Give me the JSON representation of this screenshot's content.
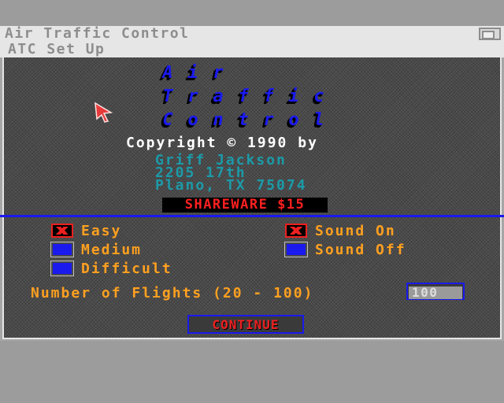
{
  "window": {
    "title": "Air Traffic Control",
    "menu": "ATC Set Up"
  },
  "logo": {
    "row1": [
      "A",
      "i",
      "r"
    ],
    "row2": [
      "T",
      "r",
      "a",
      "f",
      "f",
      "i",
      "c"
    ],
    "row3": [
      "C",
      "o",
      "n",
      "t",
      "r",
      "o",
      "l"
    ]
  },
  "info": {
    "copyright": "Copyright © 1990 by",
    "author": "Griff Jackson",
    "street": "2205 17th",
    "city": "Plano, TX 75074",
    "shareware": "SHAREWARE $15"
  },
  "difficulty": {
    "options": [
      {
        "label": "Easy",
        "checked": true
      },
      {
        "label": "Medium",
        "checked": false
      },
      {
        "label": "Difficult",
        "checked": false
      }
    ]
  },
  "sound": {
    "options": [
      {
        "label": "Sound On",
        "checked": true
      },
      {
        "label": "Sound Off",
        "checked": false
      }
    ]
  },
  "flights": {
    "label": "Number of Flights (20 - 100)",
    "value": "100"
  },
  "continue_label": "CONTINUE",
  "colors": {
    "accent_blue": "#1a1aee",
    "option_orange": "#ffa020",
    "alert_red": "#ee2020",
    "address_cyan": "#1c9aa8"
  },
  "icons": {
    "pointer": "arrow-cursor-icon",
    "depth": "window-depth-icon"
  }
}
